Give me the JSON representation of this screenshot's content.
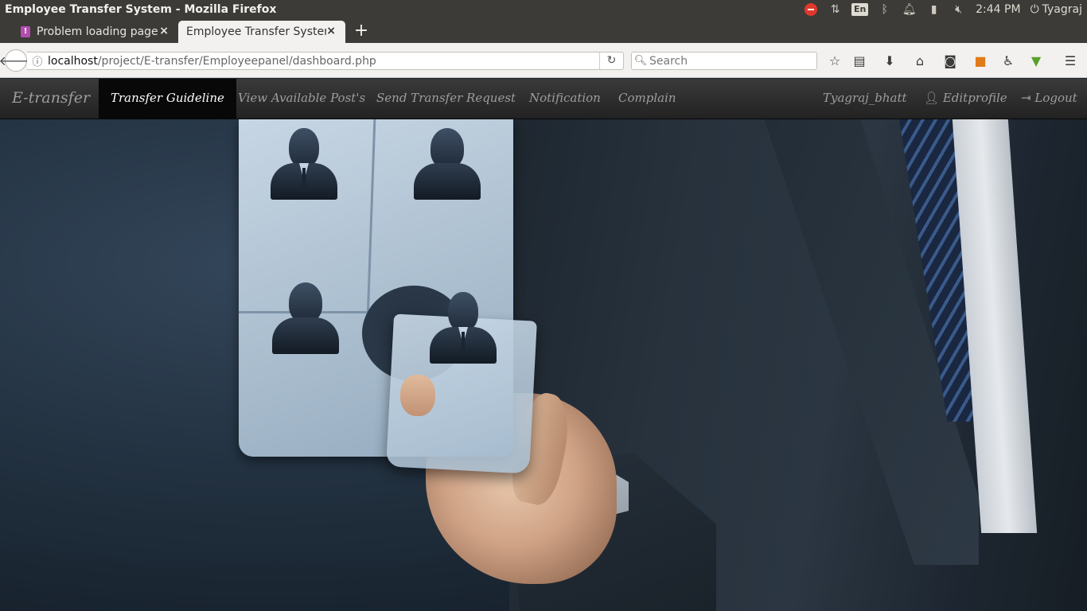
{
  "os": {
    "window_title": "Employee Transfer System - Mozilla Firefox",
    "keyboard_layout": "En",
    "clock": "2:44 PM",
    "user": "Tyagraj"
  },
  "browser": {
    "tabs": [
      {
        "label": "Problem loading page",
        "close": "×",
        "fav": "!"
      },
      {
        "label": "Employee Transfer System",
        "close": "×"
      }
    ],
    "new_tab": "+",
    "url_host": "localhost",
    "url_path": "/project/E-transfer/Employeepanel/dashboard.php",
    "search_placeholder": "Search"
  },
  "app": {
    "brand": "E-transfer",
    "nav": [
      "Transfer Guideline",
      "View Available Post's",
      "Send Transfer Request",
      "Notification",
      "Complain"
    ],
    "active_nav": "Transfer Guideline",
    "user": "Tyagraj_bhatt",
    "edit_profile": "Editprofile",
    "logout": "Logout"
  }
}
